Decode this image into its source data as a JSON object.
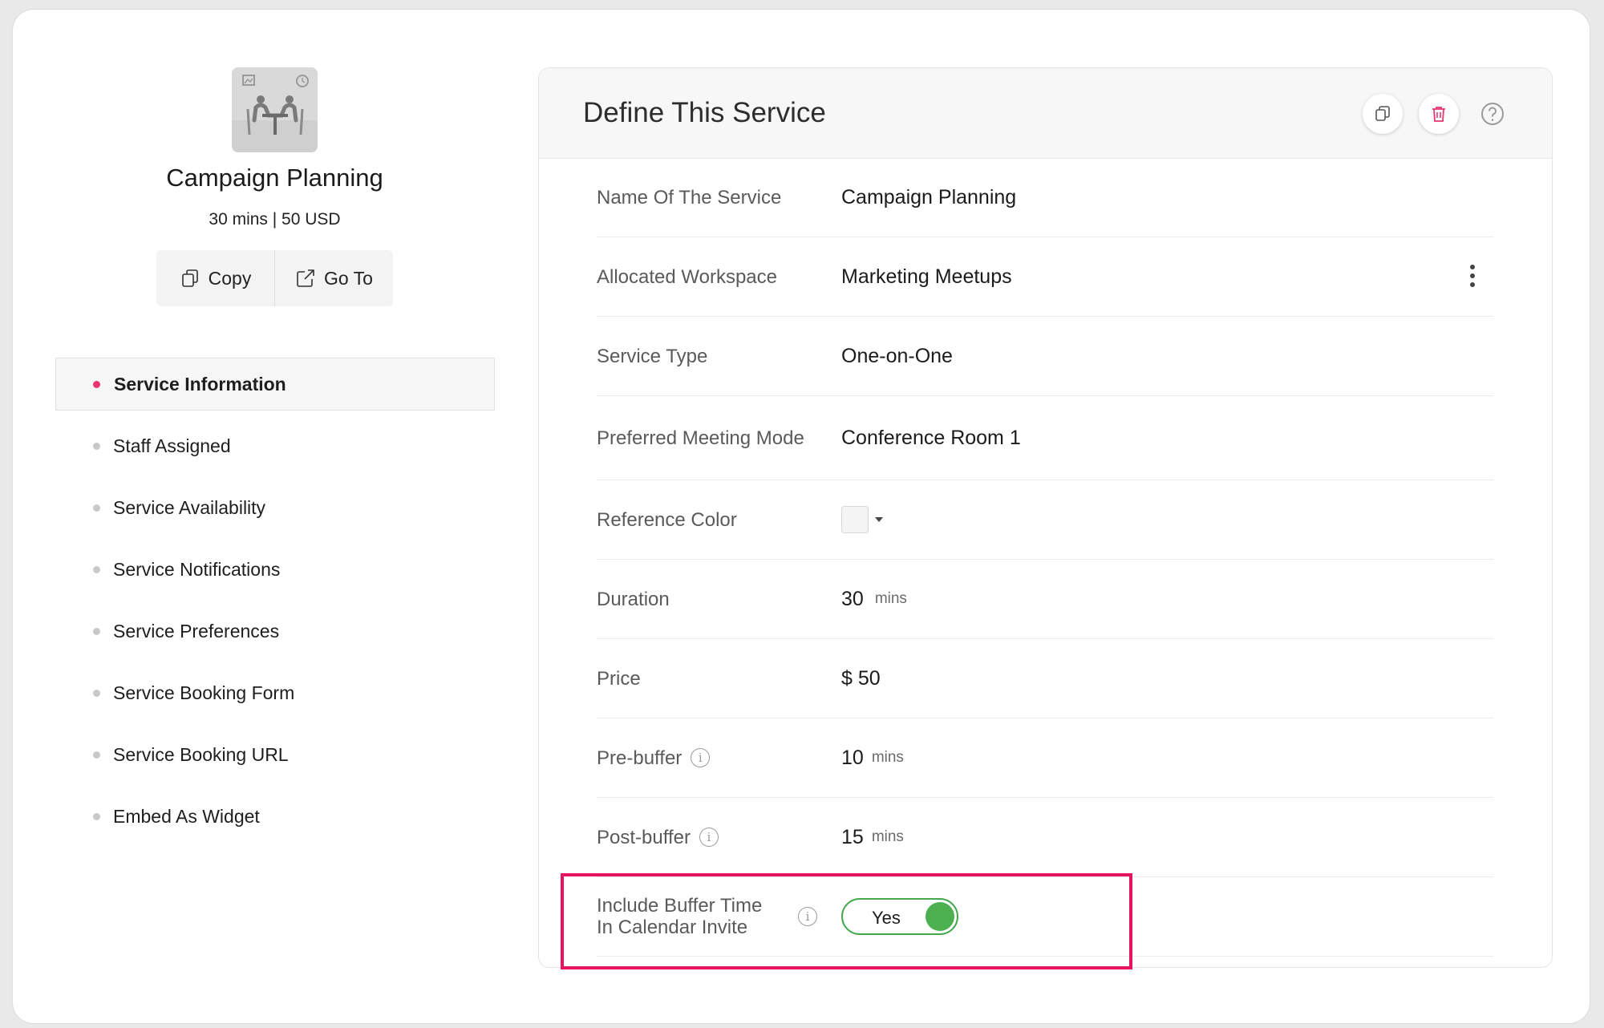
{
  "sidebar": {
    "service_title": "Campaign Planning",
    "service_meta": "30 mins | 50 USD",
    "copy_label": "Copy",
    "goto_label": "Go To",
    "active_color": "#e8356e",
    "nav": [
      {
        "label": "Service Information",
        "active": true
      },
      {
        "label": "Staff Assigned"
      },
      {
        "label": "Service Availability"
      },
      {
        "label": "Service Notifications"
      },
      {
        "label": "Service Preferences"
      },
      {
        "label": "Service Booking Form"
      },
      {
        "label": "Service Booking URL"
      },
      {
        "label": "Embed As Widget"
      }
    ]
  },
  "card": {
    "title": "Define This Service",
    "icons": [
      "copy-icon",
      "trash-icon",
      "help-icon"
    ],
    "rows": {
      "name": {
        "label": "Name Of The Service",
        "value": "Campaign Planning"
      },
      "workspace": {
        "label": "Allocated Workspace",
        "value": "Marketing Meetups"
      },
      "type": {
        "label": "Service Type",
        "value": "One-on-One"
      },
      "mode": {
        "label": "Preferred Meeting Mode",
        "value": "Conference Room 1"
      },
      "color": {
        "label": "Reference Color"
      },
      "duration": {
        "label": "Duration",
        "value": "30",
        "unit": "mins"
      },
      "price": {
        "label": "Price",
        "value": "$ 50"
      },
      "prebuffer": {
        "label": "Pre-buffer",
        "value": "10",
        "unit": "mins"
      },
      "postbuffer": {
        "label": "Post-buffer",
        "value": "15",
        "unit": "mins"
      },
      "include_buffer": {
        "label": "Include Buffer Time In Calendar Invite",
        "toggle_label": "Yes",
        "toggle_on": true
      }
    }
  },
  "colors": {
    "toggle_on": "#4caf50",
    "highlight": "#e8135f"
  }
}
